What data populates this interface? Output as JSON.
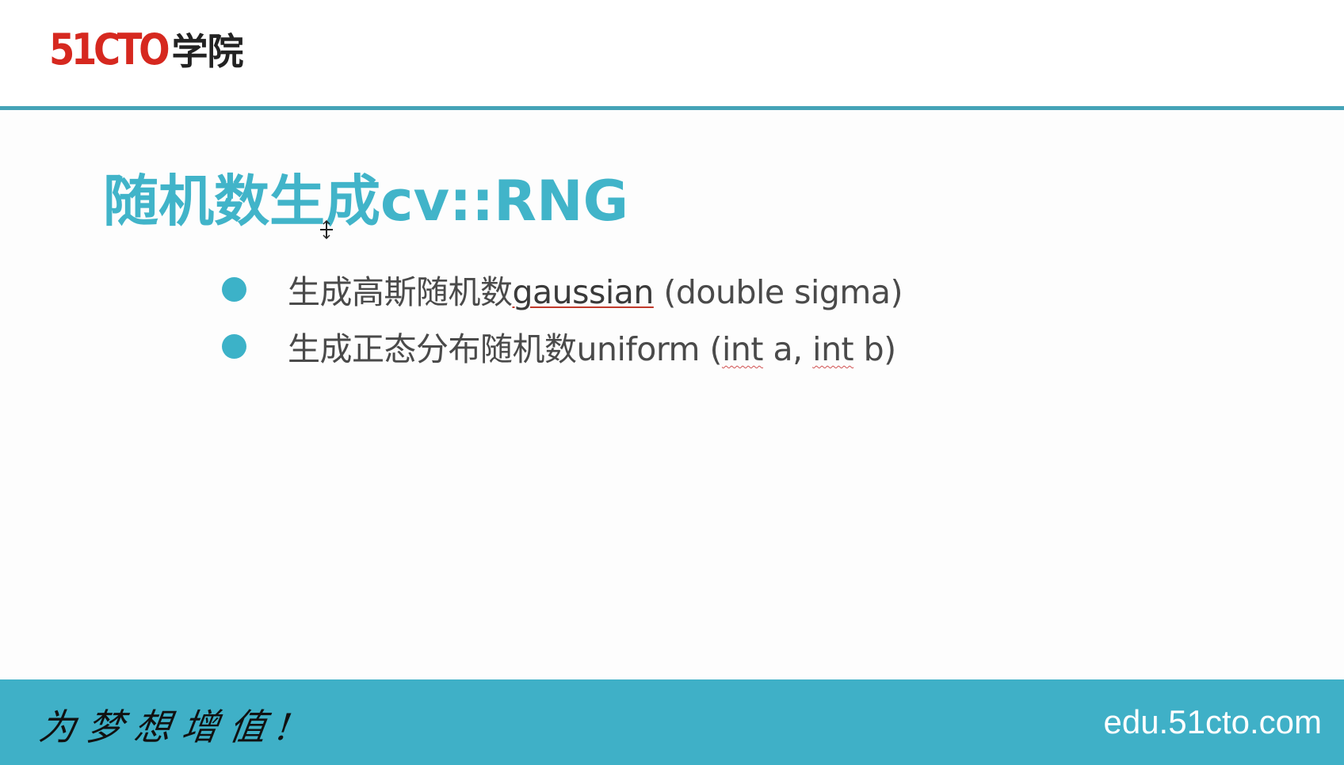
{
  "header": {
    "logo_brand": "51CTO",
    "logo_suffix": "学院"
  },
  "slide": {
    "title": "随机数生成cv::RNG",
    "bullets": [
      {
        "prefix": "生成高斯随机数",
        "func": "gaussian",
        "args": " (double sigma)"
      },
      {
        "prefix": "生成正态分布随机数uniform (",
        "arg1_type": "int",
        "arg1_name": " a, ",
        "arg2_type": "int",
        "arg2_name": " b)"
      }
    ]
  },
  "footer": {
    "slogan": "为梦想增值!",
    "site": "edu.51cto.com"
  },
  "colors": {
    "accent": "#41b4c9",
    "footer_bg": "#3fb0c7",
    "logo_red": "#d6281f"
  },
  "icons": [
    "bullet-dot-icon",
    "cursor-icon"
  ]
}
